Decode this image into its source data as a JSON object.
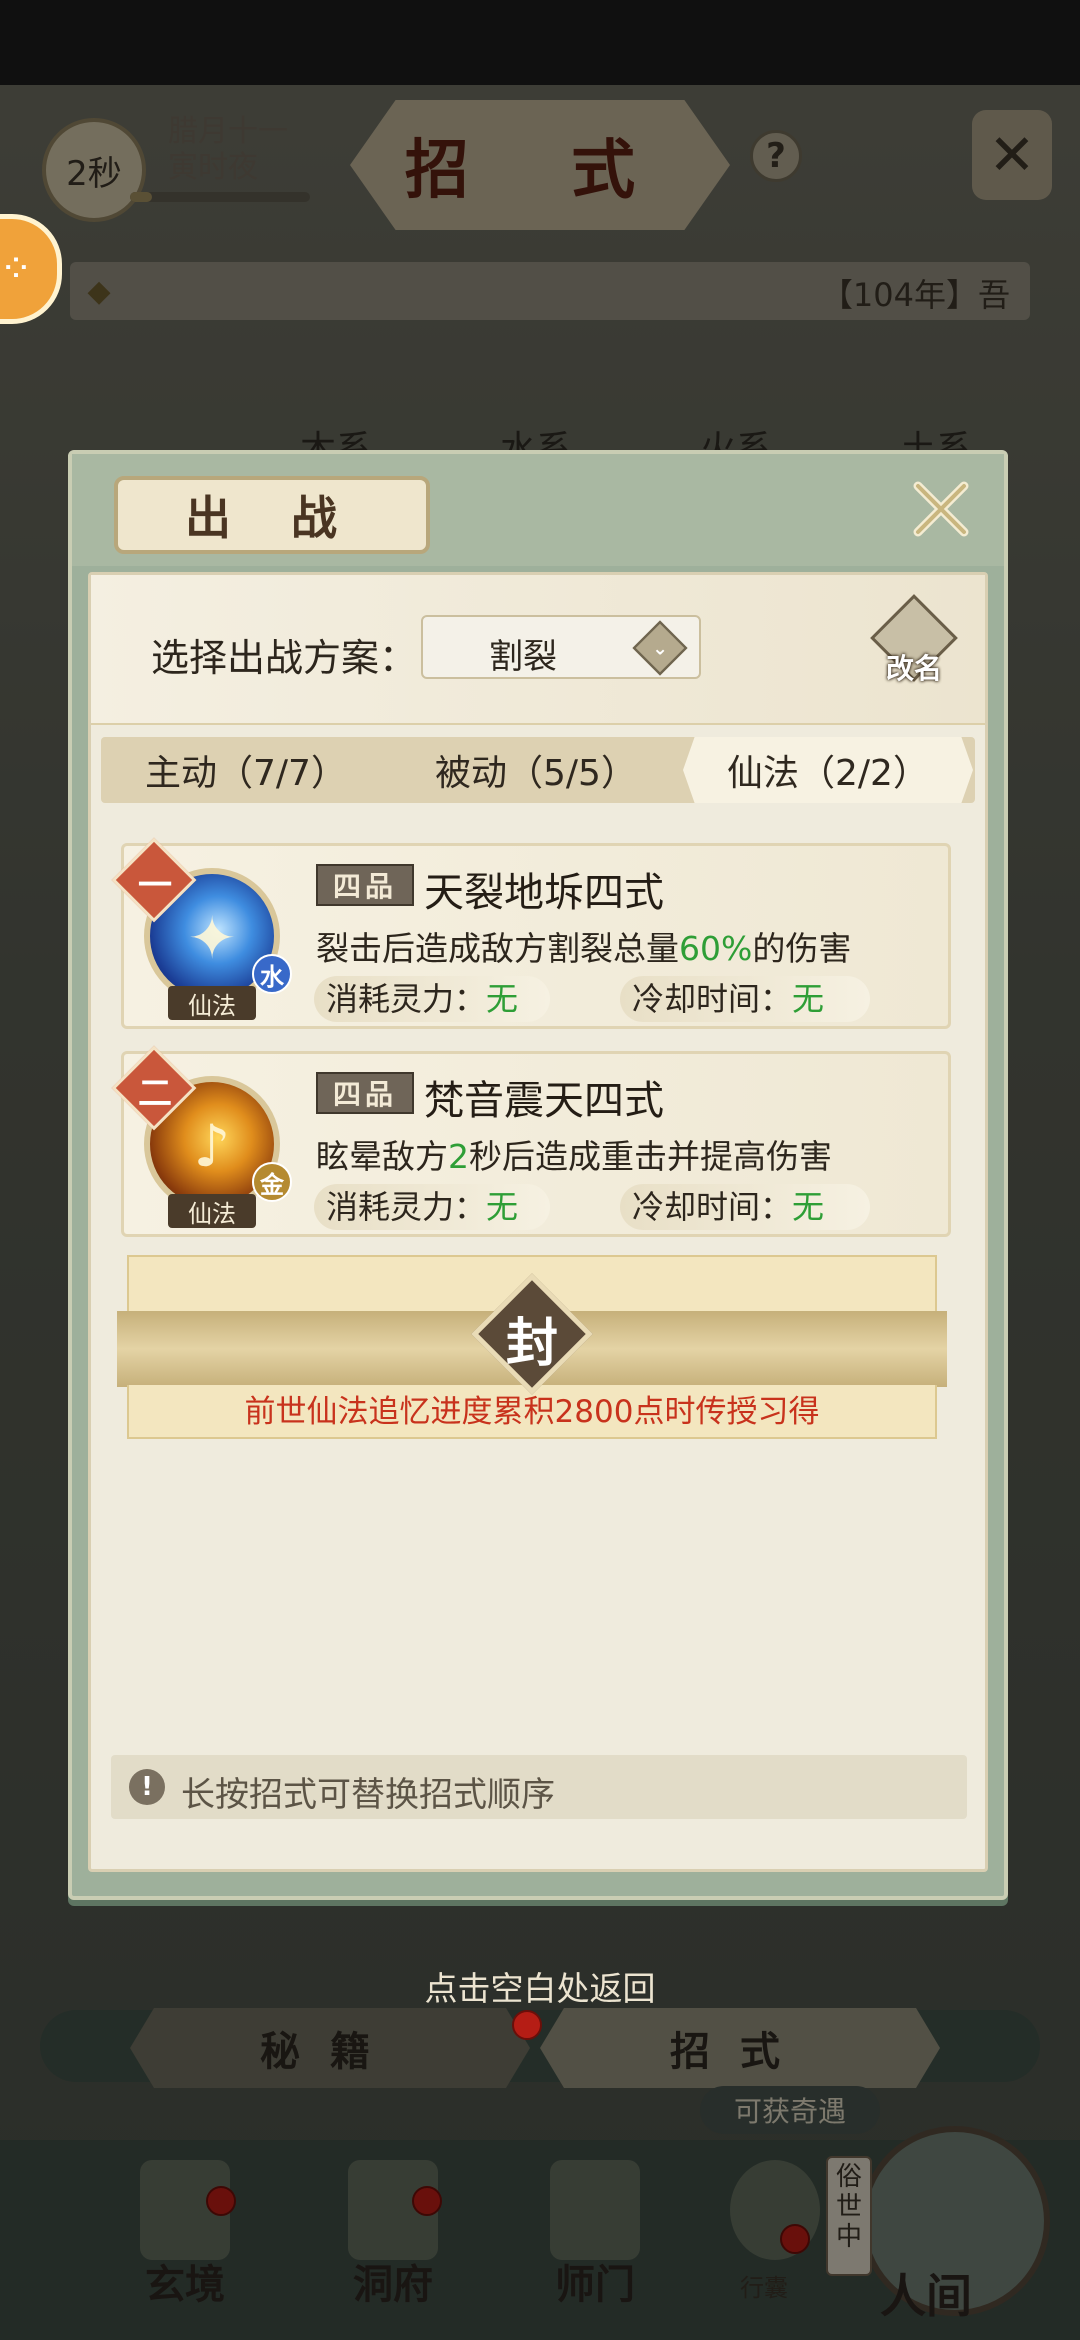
{
  "hud": {
    "timer": "2秒",
    "lunar_date_line1": "腊月十一",
    "lunar_date_line2": "寅时夜",
    "page_title": "招 式",
    "help": "?",
    "news": "【104年】吾"
  },
  "background_tabs": [
    "木系",
    "水系",
    "火系",
    "土系"
  ],
  "modal": {
    "title": "出 战",
    "scheme_label": "选择出战方案：",
    "scheme_value": "割裂",
    "rename_label": "改名",
    "tabs": [
      {
        "label": "主动（7/7）",
        "active": false
      },
      {
        "label": "被动（5/5）",
        "active": false
      },
      {
        "label": "仙法（2/2）",
        "active": true
      }
    ],
    "skills": [
      {
        "rank": "一",
        "grade": "四品",
        "name": "天裂地坼四式",
        "desc_pre": "裂击后造成敌方割裂总量",
        "desc_highlight": "60%",
        "desc_post": "的伤害",
        "element": "水",
        "type": "仙法",
        "cost_label": "消耗灵力：",
        "cost_value": "无",
        "cooldown_label": "冷却时间：",
        "cooldown_value": "无"
      },
      {
        "rank": "二",
        "grade": "四品",
        "name": "梵音震天四式",
        "desc_pre": "眩晕敌方",
        "desc_highlight": "2",
        "desc_post": "秒后造成重击并提高伤害",
        "element": "金",
        "type": "仙法",
        "cost_label": "消耗灵力：",
        "cost_value": "无",
        "cooldown_label": "冷却时间：",
        "cooldown_value": "无"
      }
    ],
    "sealed": {
      "seal": "封",
      "text": "前世仙法追忆进度累积2800点时传授习得"
    },
    "tip": "长按招式可替换招式顺序"
  },
  "return_hint": "点击空白处返回",
  "bottom_tabs": [
    {
      "label": "秘籍",
      "active": false
    },
    {
      "label": "招式",
      "active": true
    }
  ],
  "chance_badge": "可获奇遇",
  "nav": [
    {
      "label": "玄境"
    },
    {
      "label": "洞府"
    },
    {
      "label": "师门"
    },
    {
      "label": "行囊"
    }
  ],
  "realm": {
    "tag": "俗世中",
    "label": "人间"
  },
  "colors": {
    "highlight_green": "#2e9e36",
    "seal_red_text": "#c8321c",
    "rank_badge": "#c9573b"
  }
}
